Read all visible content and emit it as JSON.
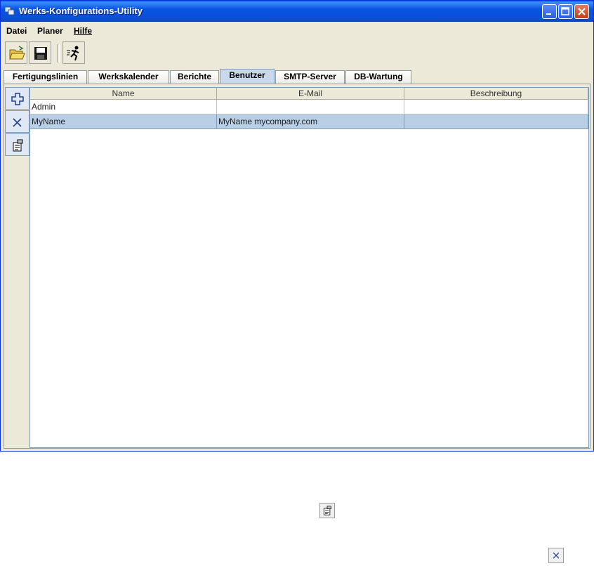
{
  "window": {
    "title": "Werks-Konfigurations-Utility"
  },
  "menu": [
    "Datei",
    "Planer",
    "Hilfe"
  ],
  "toolbar": {
    "icons": [
      "open-folder-icon",
      "save-disk-icon",
      "run-icon"
    ]
  },
  "tabs": [
    "Fertigungslinien",
    "Werkskalender",
    "Berichte",
    "Benutzer",
    "SMTP-Server",
    "DB-Wartung"
  ],
  "active_tab": "Benutzer",
  "side_buttons": [
    "add-icon",
    "delete-icon",
    "properties-icon"
  ],
  "table": {
    "columns": [
      "Name",
      "E-Mail",
      "Beschreibung"
    ],
    "rows": [
      [
        "Admin",
        "",
        ""
      ],
      [
        "MyName",
        "MyName mycompany.com",
        ""
      ]
    ],
    "selected_row": 1
  },
  "loose_icons": [
    "properties-icon",
    "delete-icon"
  ],
  "colors": {
    "titlebar": "#0a4ed6",
    "selection": "#b8cfe5",
    "window_bg": "#ece9d8"
  }
}
